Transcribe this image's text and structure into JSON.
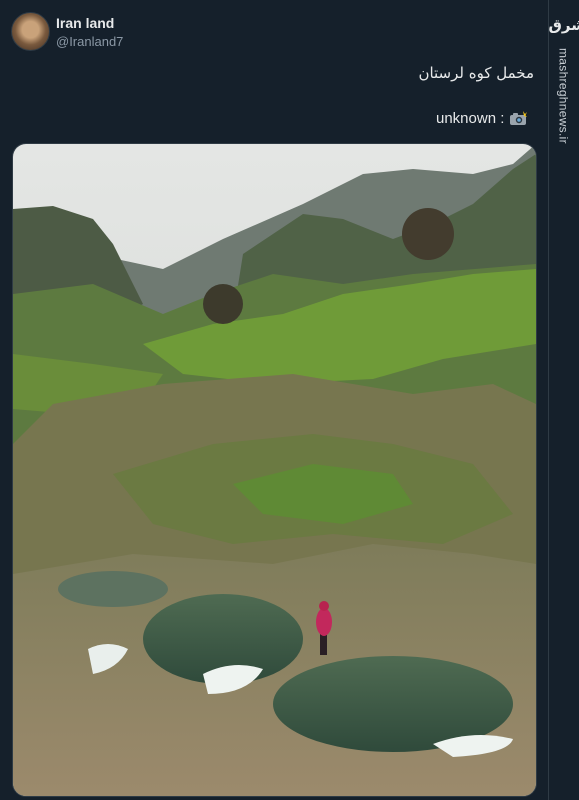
{
  "author": {
    "name": "Iran land",
    "handle": "@Iranland7"
  },
  "tweet": {
    "text": "مخمل کوه لرستان",
    "credit_label": "unknown :",
    "credit_icon": "camera-flash-icon"
  },
  "watermark": {
    "logo_text": "مشرق",
    "site": "mashreghnews.ir"
  },
  "colors": {
    "background": "#15202b",
    "text_primary": "#e7e9ea",
    "text_secondary": "#8b98a5"
  }
}
